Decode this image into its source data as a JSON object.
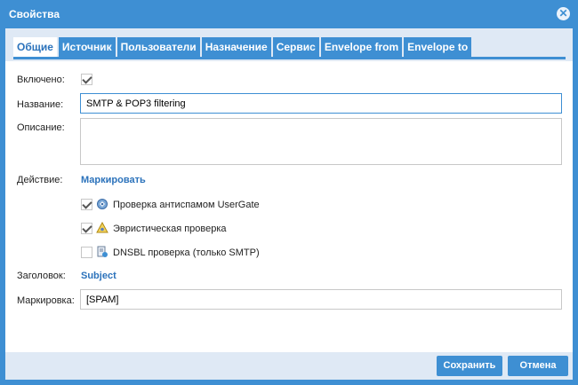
{
  "dialog": {
    "title": "Свойства"
  },
  "tabs": [
    {
      "label": "Общие",
      "active": true
    },
    {
      "label": "Источник",
      "active": false
    },
    {
      "label": "Пользователи",
      "active": false
    },
    {
      "label": "Назначение",
      "active": false
    },
    {
      "label": "Сервис",
      "active": false
    },
    {
      "label": "Envelope from",
      "active": false
    },
    {
      "label": "Envelope to",
      "active": false
    }
  ],
  "form": {
    "enabled_label": "Включено:",
    "enabled_checked": true,
    "name_label": "Название:",
    "name_value": "SMTP & POP3 filtering",
    "description_label": "Описание:",
    "description_value": "",
    "action_label": "Действие:",
    "action_value": "Маркировать",
    "options": [
      {
        "label": "Проверка антиспамом UserGate",
        "checked": true,
        "icon": "usergate-antispam-icon"
      },
      {
        "label": "Эвристическая проверка",
        "checked": true,
        "icon": "heuristic-check-icon"
      },
      {
        "label": "DNSBL проверка (только SMTP)",
        "checked": false,
        "icon": "dnsbl-check-icon"
      }
    ],
    "header_label": "Заголовок:",
    "header_value": "Subject",
    "marking_label": "Маркировка:",
    "marking_value": "[SPAM]"
  },
  "footer": {
    "save_label": "Сохранить",
    "cancel_label": "Отмена"
  },
  "colors": {
    "accent": "#3e8fd3",
    "panel_header": "#dfe9f5",
    "link": "#2b72bb"
  }
}
